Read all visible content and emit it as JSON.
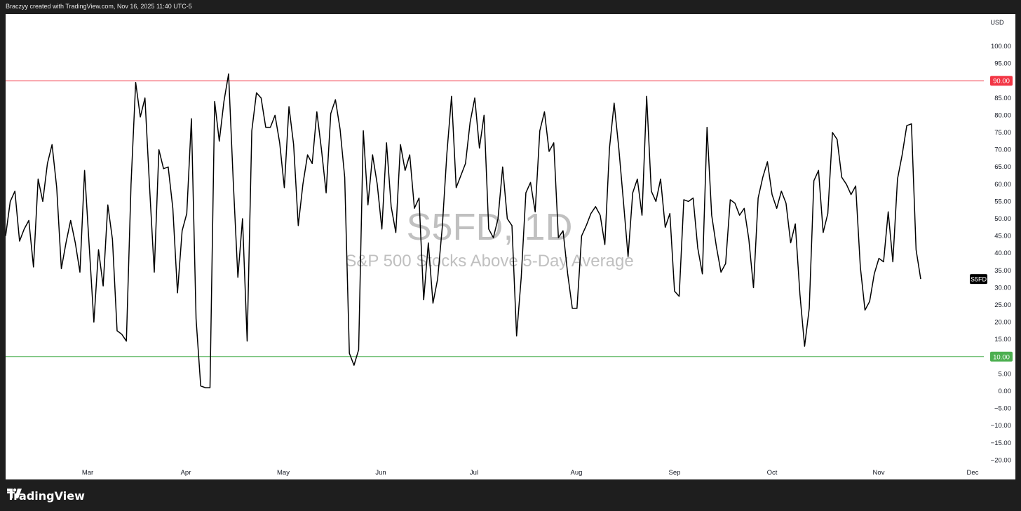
{
  "header": {
    "credit": "Braczyy created with TradingView.com, Nov 16, 2025 11:40 UTC-5"
  },
  "footer": {
    "brand": "TradingView"
  },
  "watermark": {
    "symbol": "S5FD, 1D",
    "name": "S&P 500 Stocks Above 5-Day Average"
  },
  "currency": "USD",
  "colors": {
    "line": "#000000",
    "upper_level": "#f23645",
    "lower_level": "#4caf50",
    "price_tag": "#000000",
    "watermark": "#c0c0c0"
  },
  "chart_data": {
    "type": "line",
    "title": "S5FD, 1D",
    "series": [
      {
        "name": "S5FD",
        "values": [
          45,
          55,
          58,
          43.5,
          47,
          49.5,
          36,
          61.5,
          55,
          66,
          71.5,
          59,
          35.5,
          43,
          49.5,
          43,
          34.5,
          64,
          42,
          20,
          41,
          30.5,
          54,
          44,
          17.5,
          16.5,
          14.5,
          60,
          89.5,
          79.5,
          85,
          59,
          34.5,
          70,
          64.5,
          65,
          53,
          28.5,
          46.5,
          51.5,
          79,
          21,
          1.5,
          1,
          1,
          84,
          72.5,
          84,
          92,
          61,
          33,
          50,
          14.5,
          75.5,
          86.5,
          85,
          76.5,
          76.5,
          80,
          72,
          59,
          82.5,
          71.5,
          48,
          60,
          68.5,
          66,
          81,
          70,
          57.5,
          80.5,
          84.5,
          76,
          62,
          11,
          7.5,
          12,
          75.5,
          54,
          68.5,
          60,
          47,
          72,
          53.5,
          46,
          71.5,
          64,
          68.5,
          53,
          56,
          26.5,
          43,
          25.5,
          32.5,
          47.5,
          69,
          85.5,
          59,
          62.5,
          66,
          78,
          85,
          70.5,
          80,
          47,
          44.5,
          50,
          65,
          50,
          48,
          16,
          33,
          57.5,
          60.5,
          52,
          75.5,
          81,
          69.5,
          72,
          44.5,
          46.5,
          34,
          24,
          24,
          45,
          48,
          51.5,
          53.5,
          51,
          42.5,
          70.5,
          83.5,
          70.5,
          55,
          39,
          57.5,
          61.5,
          51,
          85.5,
          58,
          55,
          61.5,
          47.5,
          51.5,
          29,
          27.5,
          55.5,
          55,
          56,
          41.5,
          34,
          76.5,
          51,
          42,
          34.5,
          37,
          55.5,
          54.5,
          51,
          53,
          44,
          30,
          56,
          62,
          66.5,
          57,
          53,
          58,
          54.5,
          43,
          48.5,
          28,
          13,
          24,
          61,
          64,
          46,
          51.5,
          75,
          73,
          62,
          60,
          57,
          59.5,
          36,
          23.5,
          26,
          34,
          38.5,
          37.5,
          52,
          37.5,
          61.5,
          68.5,
          77,
          77.5,
          41,
          32.5
        ]
      }
    ],
    "x_labels": [
      "Mar",
      "Apr",
      "May",
      "Jun",
      "Jul",
      "Aug",
      "Sep",
      "Oct",
      "Nov",
      "Dec"
    ],
    "y_ticks": [
      "100.00",
      "95.00",
      "85.00",
      "80.00",
      "75.00",
      "70.00",
      "65.00",
      "60.00",
      "55.00",
      "50.00",
      "45.00",
      "40.00",
      "35.00",
      "30.00",
      "25.00",
      "20.00",
      "15.00",
      "5.00",
      "0.00",
      "−5.00",
      "−10.00",
      "−15.00",
      "−20.00"
    ],
    "y_tick_values": [
      100,
      95,
      85,
      80,
      75,
      70,
      65,
      60,
      55,
      50,
      45,
      40,
      35,
      30,
      25,
      20,
      15,
      5,
      0,
      -5,
      -10,
      -15,
      -20
    ],
    "levels": [
      {
        "label": "90.00",
        "value": 90,
        "color": "#f23645"
      },
      {
        "label": "10.00",
        "value": 10,
        "color": "#4caf50"
      }
    ],
    "last_label": "S5FD",
    "ylim": [
      -21,
      104
    ],
    "grid": false,
    "legend": "none"
  }
}
